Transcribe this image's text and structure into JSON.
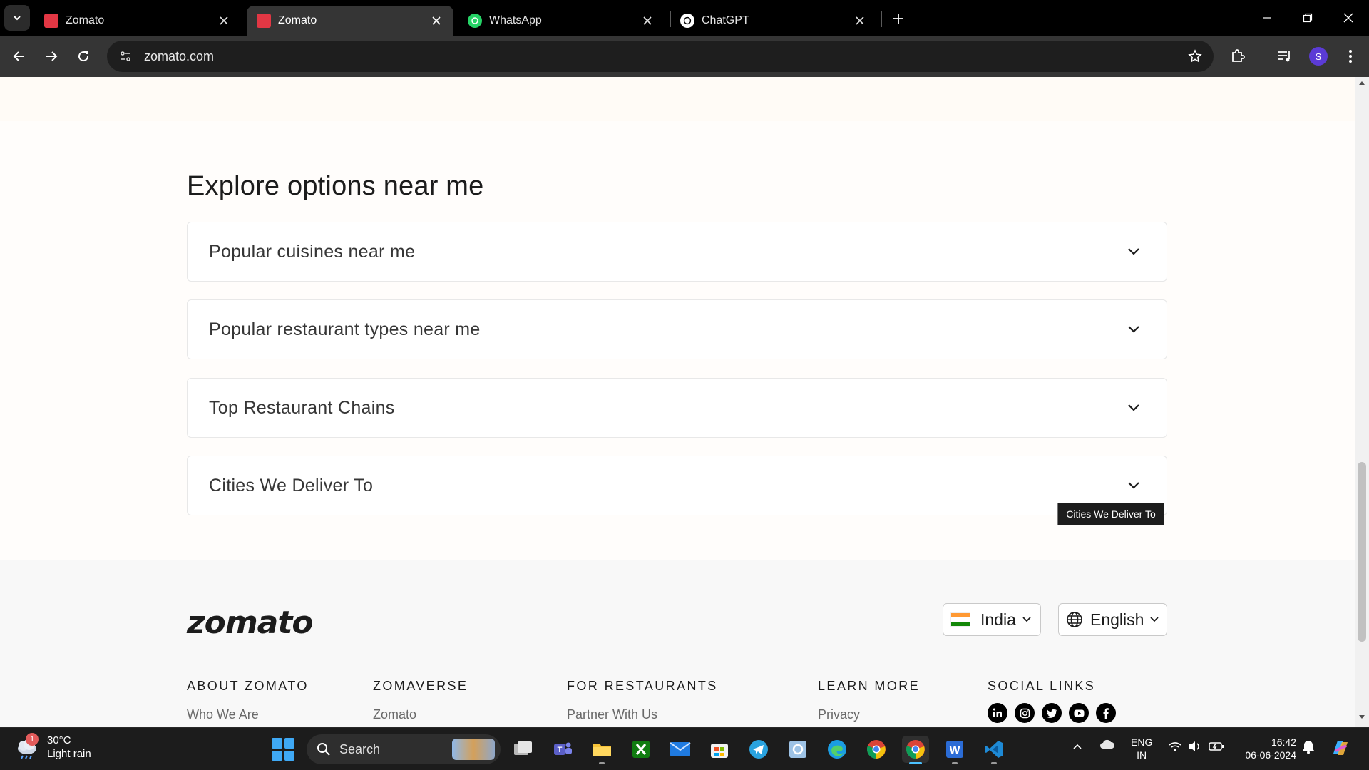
{
  "browser": {
    "tabs": [
      {
        "title": "Zomato",
        "active": false
      },
      {
        "title": "Zomato",
        "active": true
      },
      {
        "title": "WhatsApp",
        "active": false
      },
      {
        "title": "ChatGPT",
        "active": false
      }
    ],
    "url": "zomato.com",
    "profile_initial": "S"
  },
  "page": {
    "section_title": "Explore options near me",
    "accordions": [
      {
        "label": "Popular cuisines near me"
      },
      {
        "label": "Popular restaurant types near me"
      },
      {
        "label": "Top Restaurant Chains"
      },
      {
        "label": "Cities We Deliver To"
      }
    ],
    "tooltip": "Cities We Deliver To"
  },
  "footer": {
    "logo": "zomato",
    "country": "India",
    "language": "English",
    "columns": [
      {
        "heading": "ABOUT ZOMATO",
        "first_link": "Who We Are"
      },
      {
        "heading": "ZOMAVERSE",
        "first_link": "Zomato"
      },
      {
        "heading": "FOR RESTAURANTS",
        "first_link": "Partner With Us"
      },
      {
        "heading": "LEARN MORE",
        "first_link": "Privacy"
      },
      {
        "heading": "SOCIAL LINKS"
      }
    ],
    "social_icons": [
      "linkedin-icon",
      "instagram-icon",
      "twitter-icon",
      "youtube-icon",
      "facebook-icon"
    ]
  },
  "taskbar": {
    "weather_temp": "30°C",
    "weather_desc": "Light rain",
    "weather_badge": "1",
    "search_label": "Search",
    "lang_line1": "ENG",
    "lang_line2": "IN",
    "time": "16:42",
    "date": "06-06-2024"
  },
  "colors": {
    "zomato_red": "#e23744",
    "page_bg": "#fffdfb",
    "footer_bg": "#f8f8f8",
    "chrome_dark": "#353535"
  }
}
